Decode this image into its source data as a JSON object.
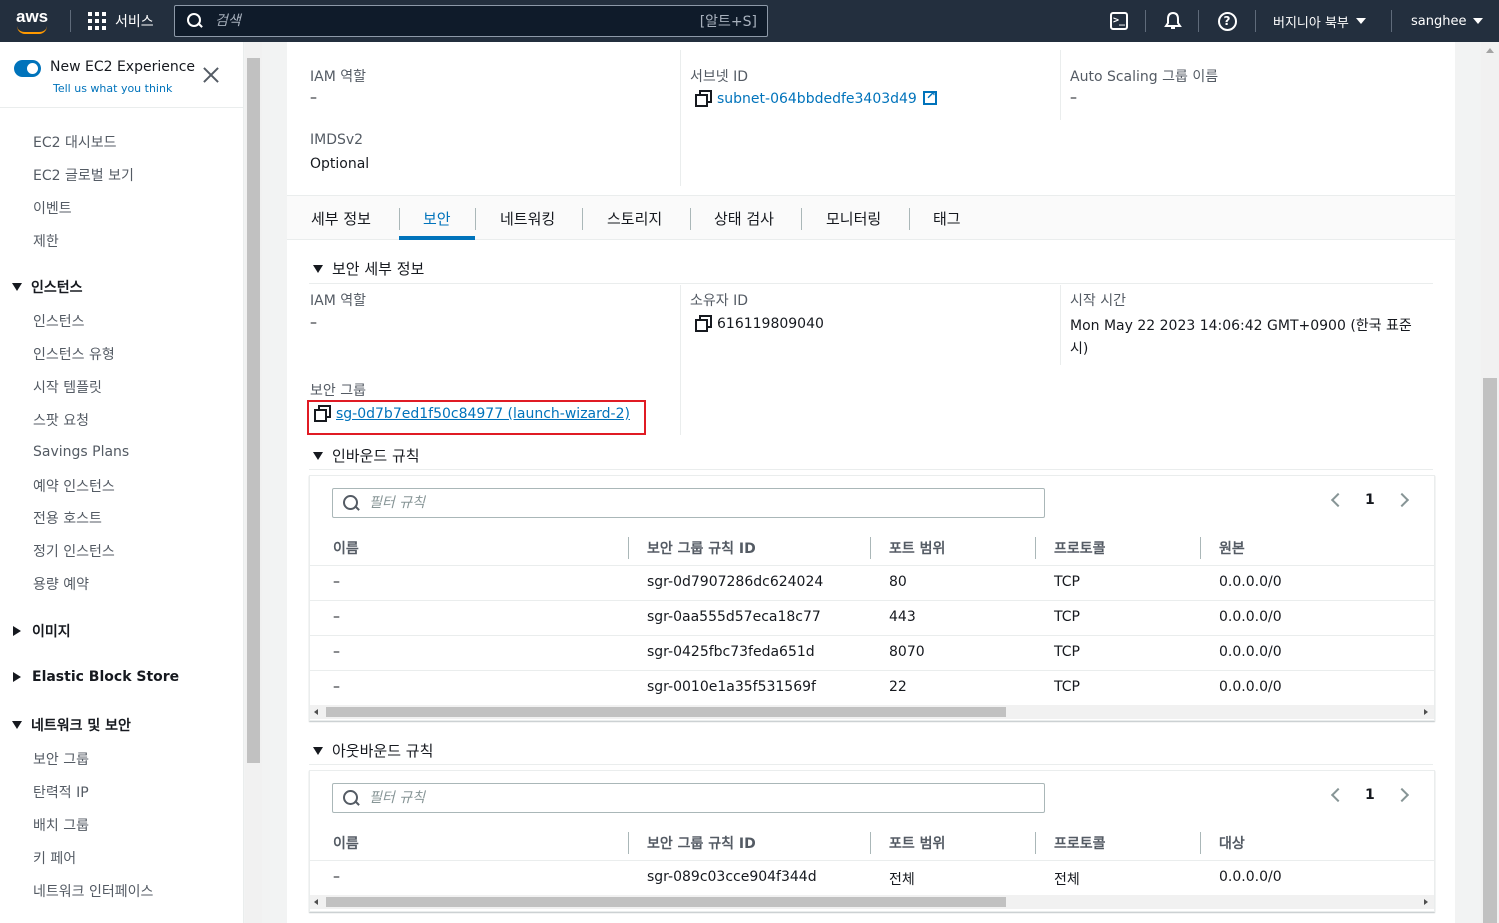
{
  "topnav": {
    "logo_text": "aws",
    "services_label": "서비스",
    "search_placeholder": "검색",
    "search_shortcut": "[알트+S]",
    "region": "버지니아 북부",
    "user": "sanghee"
  },
  "sidebar": {
    "experience_title": "New EC2 Experience",
    "experience_link": "Tell us what you think",
    "top_items": [
      "EC2 대시보드",
      "EC2 글로벌 보기",
      "이벤트",
      "제한"
    ],
    "instances_section": "인스턴스",
    "instance_items": [
      "인스턴스",
      "인스턴스 유형",
      "시작 템플릿",
      "스팟 요청",
      "Savings Plans",
      "예약 인스턴스",
      "전용 호스트",
      "정기 인스턴스",
      "용량 예약"
    ],
    "images_section": "이미지",
    "ebs_section": "Elastic Block Store",
    "network_section": "네트워크 및 보안",
    "network_items": [
      "보안 그룹",
      "탄력적 IP",
      "배치 그룹",
      "키 페어",
      "네트워크 인터페이스"
    ]
  },
  "details": {
    "iam_role_label": "IAM 역할",
    "iam_role_value": "–",
    "subnet_label": "서브넷 ID",
    "subnet_value": "subnet-064bbdedfe3403d49",
    "asg_label": "Auto Scaling 그룹 이름",
    "asg_value": "–",
    "imds_label": "IMDSv2",
    "imds_value": "Optional"
  },
  "tabs": [
    "세부 정보",
    "보안",
    "네트워킹",
    "스토리지",
    "상태 검사",
    "모니터링",
    "태그"
  ],
  "security": {
    "section_title": "보안 세부 정보",
    "iam_role_label": "IAM 역할",
    "iam_role_value": "–",
    "owner_label": "소유자 ID",
    "owner_value": "616119809040",
    "launch_label": "시작 시간",
    "launch_value_line1": "Mon May 22 2023 14:06:42 GMT+0900 (한국 표준",
    "launch_value_line2": "시)",
    "sg_label": "보안 그룹",
    "sg_value": "sg-0d7b7ed1f50c84977 (launch-wizard-2)"
  },
  "inbound": {
    "title": "인바운드 규칙",
    "filter_placeholder": "필터 규칙",
    "page": "1",
    "headers": [
      "이름",
      "보안 그룹 규칙 ID",
      "포트 범위",
      "프로토콜",
      "원본"
    ],
    "rows": [
      [
        "–",
        "sgr-0d7907286dc624024",
        "80",
        "TCP",
        "0.0.0.0/0"
      ],
      [
        "–",
        "sgr-0aa555d57eca18c77",
        "443",
        "TCP",
        "0.0.0.0/0"
      ],
      [
        "–",
        "sgr-0425fbc73feda651d",
        "8070",
        "TCP",
        "0.0.0.0/0"
      ],
      [
        "–",
        "sgr-0010e1a35f531569f",
        "22",
        "TCP",
        "0.0.0.0/0"
      ]
    ]
  },
  "outbound": {
    "title": "아웃바운드 규칙",
    "filter_placeholder": "필터 규칙",
    "page": "1",
    "headers": [
      "이름",
      "보안 그룹 규칙 ID",
      "포트 범위",
      "프로토콜",
      "대상"
    ],
    "rows": [
      [
        "–",
        "sgr-089c03cce904f344d",
        "전체",
        "전체",
        "0.0.0.0/0"
      ]
    ]
  }
}
